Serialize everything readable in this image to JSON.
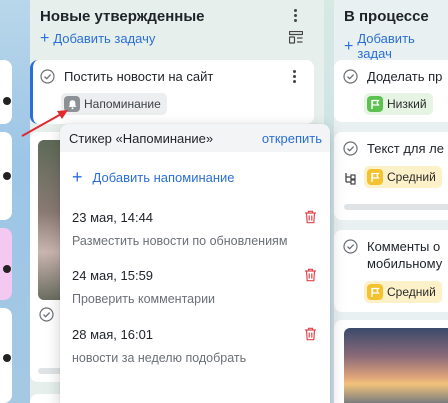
{
  "columns": [
    {
      "title": "Новые утвержденные",
      "add_task": "Добавить задачу",
      "cards": [
        {
          "title": "Постить новости на сайт",
          "chip_label": "Напоминание"
        }
      ]
    },
    {
      "title": "В процессе",
      "add_task": "Добавить задач",
      "cards": [
        {
          "title": "Доделать пр",
          "priority": "Низкий"
        },
        {
          "title": "Текст для ле",
          "priority": "Средний"
        },
        {
          "title_line1": "Комменты о",
          "title_line2": "мобильному",
          "priority": "Средний"
        }
      ]
    }
  ],
  "popover": {
    "title": "Стикер «Напоминание»",
    "unpin": "открепить",
    "add_reminder": "Добавить напоминание",
    "reminders": [
      {
        "date": "23 мая, 14:44",
        "text": "Разместить новости по обновлениям"
      },
      {
        "date": "24 мая, 15:59",
        "text": "Проверить комментарии"
      },
      {
        "date": "28 мая, 16:01",
        "text": "новости за неделю подобрать"
      }
    ]
  },
  "colors": {
    "accent": "#2b6fd6",
    "danger": "#e0474c",
    "priority_low": "#5cc24f",
    "priority_medium": "#f5c22f",
    "highlight_border": "#2b6fd6",
    "arrow": "#e0282e"
  }
}
